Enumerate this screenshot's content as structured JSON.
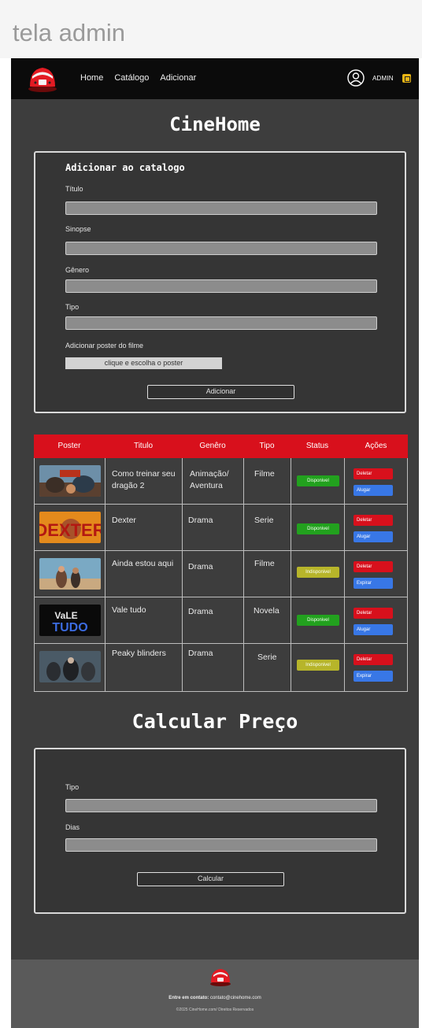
{
  "frame": {
    "label": "tela admin"
  },
  "nav": {
    "links": [
      "Home",
      "Catálogo",
      "Adicionar"
    ],
    "user_label": "ADMIN",
    "badge_color": "#e9b514"
  },
  "site": {
    "title": "CineHome"
  },
  "add_form": {
    "title": "Adicionar ao catalogo",
    "fields": [
      {
        "label": "Título",
        "value": ""
      },
      {
        "label": "Sinopse",
        "value": ""
      },
      {
        "label": "Gênero",
        "value": ""
      },
      {
        "label": "Tipo",
        "value": ""
      }
    ],
    "poster_label": "Adicionar poster do filme",
    "poster_button": "clique e escolha o poster",
    "submit": "Adicionar"
  },
  "table": {
    "header_color": "#d8101c",
    "columns": [
      "Poster",
      "Titulo",
      "Genêro",
      "Tipo",
      "Status",
      "Ações"
    ],
    "rows": [
      {
        "poster": "dragon-poster",
        "title": "Como treinar seu dragão 2",
        "genre": "Animação/ Aventura",
        "type": "Filme",
        "status": "Disponivel",
        "status_color": "#22a11e",
        "action_1": "Deletar",
        "action_2": "Alugar"
      },
      {
        "poster": "dexter-poster",
        "title": "Dexter",
        "genre": "Drama",
        "type": "Serie",
        "status": "Disponivel",
        "status_color": "#22a11e",
        "action_1": "Deletar",
        "action_2": "Alugar"
      },
      {
        "poster": "ainda-estou-aqui-poster",
        "title": "Ainda estou aqui",
        "genre": "Drama",
        "type": "Filme",
        "status": "Indisponivel",
        "status_color": "#b7b52a",
        "action_1": "Deletar",
        "action_2": "Expirar"
      },
      {
        "poster": "vale-tudo-poster",
        "title": "Vale tudo",
        "genre": "Drama",
        "type": "Novela",
        "status": "Disponivel",
        "status_color": "#22a11e",
        "action_1": "Deletar",
        "action_2": "Alugar"
      },
      {
        "poster": "peaky-blinders-poster",
        "title": "Peaky blinders",
        "genre": "Drama",
        "type": "Serie",
        "status": "Indisponivel",
        "status_color": "#b7b52a",
        "action_1": "Deletar",
        "action_2": "Expirar"
      }
    ]
  },
  "calc": {
    "title": "Calcular Preço",
    "fields": [
      {
        "label": "Tipo",
        "value": ""
      },
      {
        "label": "Dias",
        "value": ""
      }
    ],
    "submit": "Calcular"
  },
  "footer": {
    "contact_label": "Entre em contato:",
    "contact_email": "contato@cinehome.com",
    "copyright": "©2025 CineHome.com/ Direitos Reservados"
  }
}
